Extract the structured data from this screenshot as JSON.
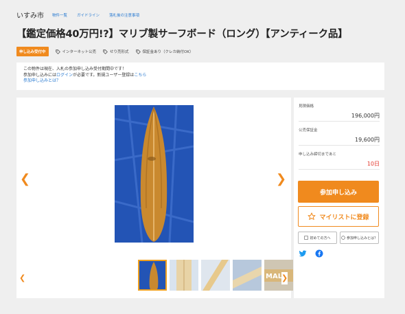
{
  "header": {
    "site_name": "いすみ市",
    "nav": [
      "物件一覧",
      "ガイドライン",
      "落札後の注意事項"
    ]
  },
  "title": "【鑑定価格40万円!?】マリブ製サーフボード（ロング）【アンティーク品】",
  "tags": {
    "badge": "申し込み受付中",
    "items": [
      {
        "label": "インターネット公売",
        "icon": "tag-icon"
      },
      {
        "label": "せり売形式",
        "icon": "tag-icon"
      },
      {
        "label": "保証金あり（クレカ納付OK）",
        "icon": "tag-icon"
      }
    ]
  },
  "notice": {
    "line1": "この物件は現在、入札の参加申し込み受付期間中です！",
    "line2_prefix": "参加申し込みには",
    "line2_login": "ログイン",
    "line2_mid": "が必要です。新規ユーザー登録は",
    "line2_here": "こちら",
    "line3": "参加申し込みとは？"
  },
  "side": {
    "rows": [
      {
        "label": "見積価格",
        "value": "196,000円"
      },
      {
        "label": "公売保証金",
        "value": "19,600円"
      },
      {
        "label": "申し込み締切まであと",
        "value": "10日"
      }
    ],
    "apply_label": "参加申し込み",
    "mylist_label": "マイリストに登録",
    "first_time_label": "初めての方へ",
    "what_is_label": "参加申し込みとは？"
  },
  "gallery": {
    "thumb_text": "MALI"
  },
  "colors": {
    "accent": "#f08a1e",
    "link": "#2a7bd1",
    "deadline": "#e3372b",
    "twitter": "#1d9bf0",
    "facebook": "#1877f2"
  }
}
